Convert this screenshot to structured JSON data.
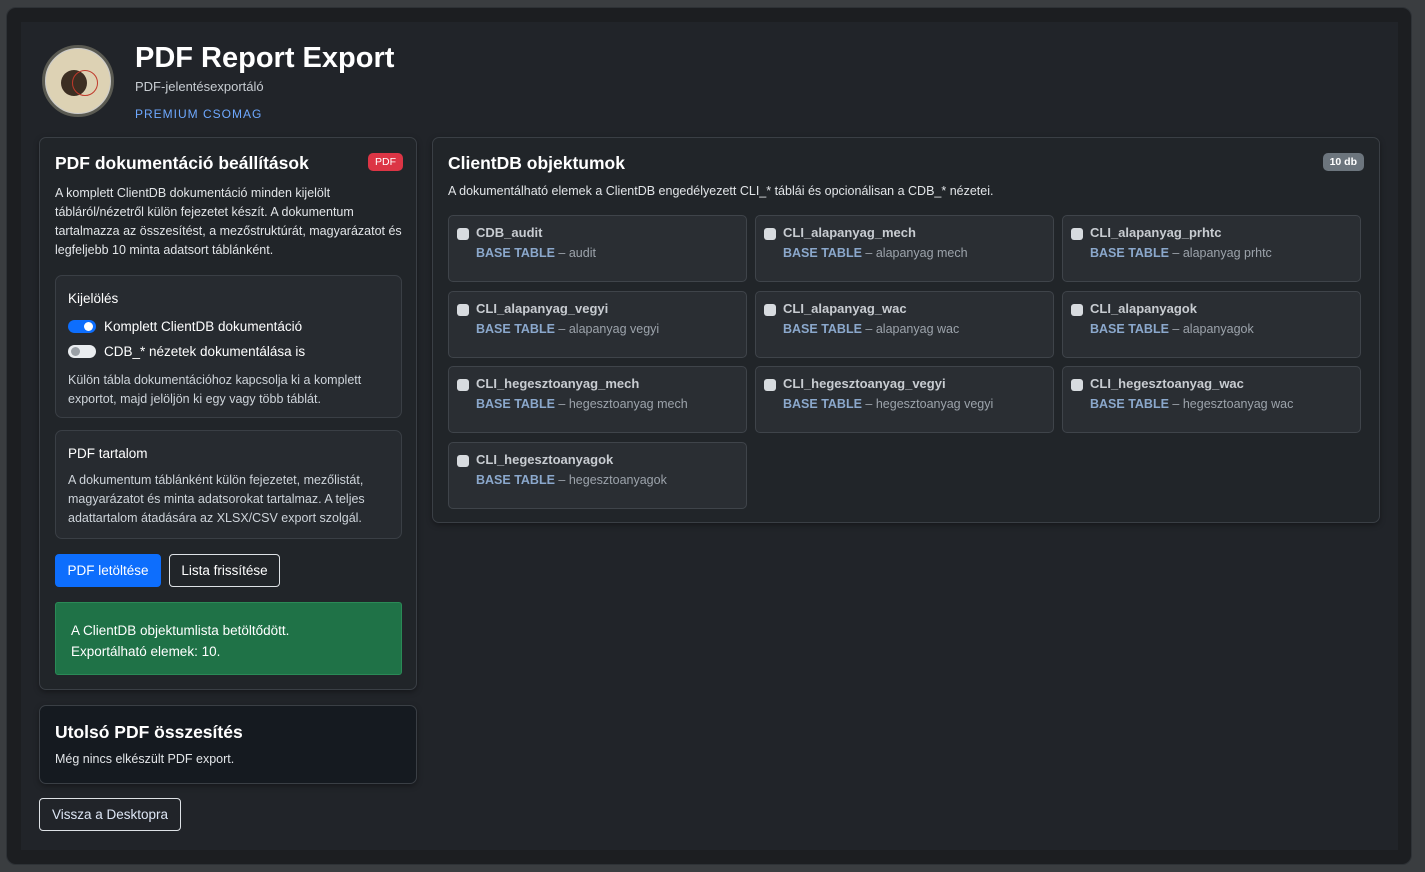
{
  "header": {
    "title": "PDF Report Export",
    "subtitle": "PDF-jelentésexportáló",
    "package": "PREMIUM CSOMAG"
  },
  "settings": {
    "title": "PDF dokumentáció beállítások",
    "badge": "PDF",
    "description": "A komplett ClientDB dokumentáció minden kijelölt tábláról/nézetről külön fejezetet készít. A dokumentum tartalmazza az összesítést, a mezőstruktúrát, magyarázatot és legfeljebb 10 minta adatsort táblánként.",
    "selection": {
      "title": "Kijelölés",
      "toggle_full": {
        "label": "Komplett ClientDB dokumentáció",
        "on": true
      },
      "toggle_views": {
        "label": "CDB_* nézetek dokumentálása is",
        "on": false
      },
      "hint": "Külön tábla dokumentációhoz kapcsolja ki a komplett exportot, majd jelöljön ki egy vagy több táblát."
    },
    "content": {
      "title": "PDF tartalom",
      "text": "A dokumentum táblánként külön fejezetet, mezőlistát, magyarázatot és minta adatsorokat tartalmaz. A teljes adattartalom átadására az XLSX/CSV export szolgál."
    },
    "download_label": "PDF letöltése",
    "refresh_label": "Lista frissítése",
    "alert_line1": "A ClientDB objektumlista betöltődött.",
    "alert_line2": "Exportálható elemek: 10."
  },
  "objects": {
    "title": "ClientDB objektumok",
    "count_badge": "10 db",
    "description": "A dokumentálható elemek a ClientDB engedélyezett CLI_* táblái és opcionálisan a CDB_* nézetei.",
    "items": [
      {
        "name": "CDB_audit",
        "type": "BASE TABLE",
        "label": "– audit"
      },
      {
        "name": "CLI_alapanyag_mech",
        "type": "BASE TABLE",
        "label": "– alapanyag mech"
      },
      {
        "name": "CLI_alapanyag_prhtc",
        "type": "BASE TABLE",
        "label": "– alapanyag prhtc"
      },
      {
        "name": "CLI_alapanyag_vegyi",
        "type": "BASE TABLE",
        "label": "– alapanyag vegyi"
      },
      {
        "name": "CLI_alapanyag_wac",
        "type": "BASE TABLE",
        "label": "– alapanyag wac"
      },
      {
        "name": "CLI_alapanyagok",
        "type": "BASE TABLE",
        "label": "– alapanyagok"
      },
      {
        "name": "CLI_hegesztoanyag_mech",
        "type": "BASE TABLE",
        "label": "– hegesztoanyag mech"
      },
      {
        "name": "CLI_hegesztoanyag_vegyi",
        "type": "BASE TABLE",
        "label": "– hegesztoanyag vegyi"
      },
      {
        "name": "CLI_hegesztoanyag_wac",
        "type": "BASE TABLE",
        "label": "– hegesztoanyag wac"
      },
      {
        "name": "CLI_hegesztoanyagok",
        "type": "BASE TABLE",
        "label": "– hegesztoanyagok"
      }
    ]
  },
  "summary": {
    "title": "Utolsó PDF összesítés",
    "text": "Még nincs elkészült PDF export."
  },
  "back_label": "Vissza a Desktopra",
  "icons": {
    "logo": "venn-logo-icon",
    "checkbox": "checkbox-icon"
  },
  "colors": {
    "primary": "#0d6efd",
    "danger": "#dc3545",
    "success": "#1f7247"
  }
}
